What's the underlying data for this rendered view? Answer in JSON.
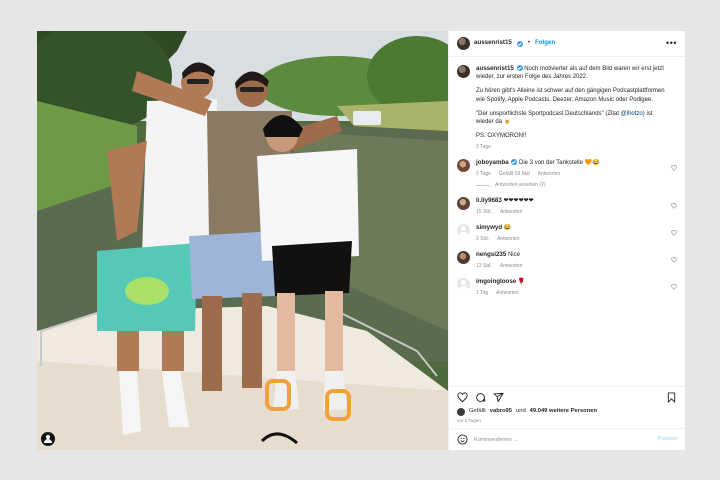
{
  "post": {
    "username": "aussenrist15",
    "follow_label": "Folgen",
    "more_label": "•••",
    "caption": {
      "line1": "Noch motivierter als auf dem Bild waren wir erst jetzt wieder, zur ersten Folge des Jahres 2022.",
      "line2": "Zu hören gibt's Alleine ist schwer auf den gängigen Podcastplattformen wie Spotify, Apple Podcasts, Deezer, Amazon Music oder Podigee.",
      "line3_before": "\"Der unsportlichste Sportpodcast Deutschlands\" (Zitat ",
      "line3_mention": "@lhotzo",
      "line3_after": ") ist wieder da 🍺",
      "line4": "PS. OXYMORON!!",
      "age": "2 Tage"
    },
    "comments": [
      {
        "user": "joboyamba",
        "verified": true,
        "text": "Die 3 von der Tankstelle 🧡😂",
        "age": "2 Tage",
        "likes": "Gefällt 59 Mal",
        "reply": "Antworten",
        "view_replies": "Antworten ansehen (2)",
        "avatar": "av-c1"
      },
      {
        "user": "li.lly9683",
        "verified": false,
        "text": "❤❤❤❤❤❤",
        "age": "15 Std.",
        "likes": "",
        "reply": "Antworten",
        "view_replies": "",
        "avatar": "av-c2"
      },
      {
        "user": "simywyd",
        "verified": false,
        "text": "😂",
        "age": "2 Std.",
        "likes": "",
        "reply": "Antworten",
        "view_replies": "",
        "avatar": "av-blank"
      },
      {
        "user": "nengsi235",
        "verified": false,
        "text": "Nice",
        "age": "13 Std.",
        "likes": "",
        "reply": "Antworten",
        "view_replies": "",
        "avatar": "av-c4"
      },
      {
        "user": "imgoingloose",
        "verified": false,
        "text": "🌹",
        "age": "1 Tag",
        "likes": "",
        "reply": "Antworten",
        "view_replies": "",
        "avatar": "av-blank"
      }
    ],
    "likes_prefix": "Gefällt",
    "likes_user": "vabro95",
    "likes_middle": "und",
    "likes_count": "49.049 weitere Personen",
    "date": "vor 2 Tagen",
    "comment_placeholder": "Kommentieren ...",
    "post_label": "Posten"
  },
  "colors": {
    "accent": "#0095f6",
    "verified": "#3897f0",
    "page_bg": "#e6e6e6"
  },
  "icons": [
    "user-tag-icon",
    "verified-icon",
    "more-icon",
    "heart-icon",
    "comment-icon",
    "share-icon",
    "save-icon",
    "emoji-icon"
  ]
}
